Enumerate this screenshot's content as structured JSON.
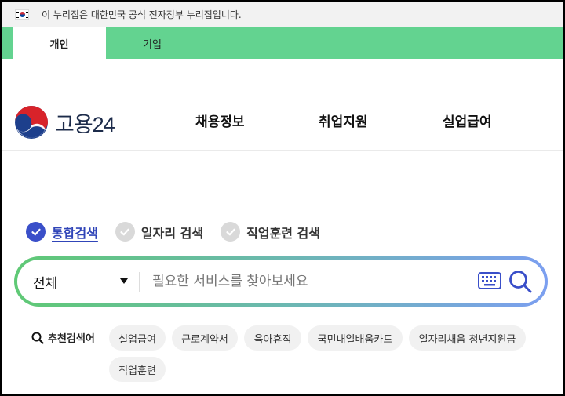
{
  "gov_banner": {
    "text": "이 누리집은 대한민국 공식 전자정부 누리집입니다."
  },
  "tabs": [
    {
      "label": "개인",
      "active": true
    },
    {
      "label": "기업",
      "active": false
    }
  ],
  "logo": {
    "text": "고용24"
  },
  "nav": [
    {
      "label": "채용정보"
    },
    {
      "label": "취업지원"
    },
    {
      "label": "실업급여"
    }
  ],
  "search_types": [
    {
      "label": "통합검색",
      "checked": true
    },
    {
      "label": "일자리 검색",
      "checked": false
    },
    {
      "label": "직업훈련 검색",
      "checked": false
    }
  ],
  "search": {
    "category_selected": "전체",
    "placeholder": "필요한 서비스를 찾아보세요",
    "value": ""
  },
  "recommended": {
    "label": "추천검색어",
    "tags": [
      "실업급여",
      "근로계약서",
      "육아휴직",
      "국민내일배움카드",
      "일자리채움 청년지원금",
      "직업훈련"
    ]
  },
  "colors": {
    "tab_green": "#63d390",
    "check_active": "#3a4fc9",
    "gradient_start": "#5fc975",
    "gradient_end": "#7c9ff0"
  }
}
